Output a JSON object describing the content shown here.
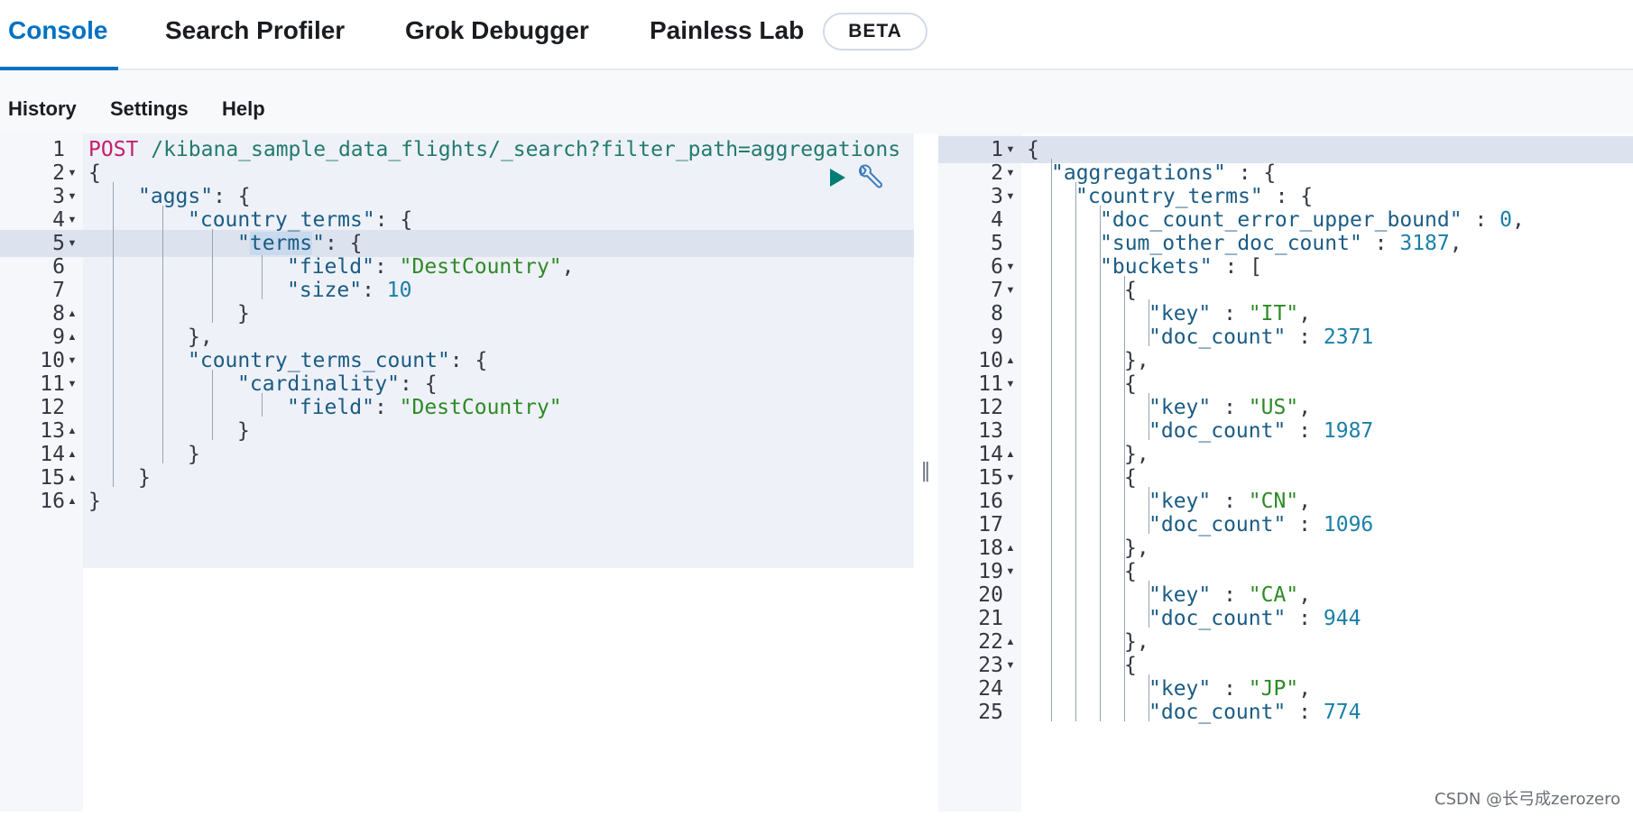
{
  "tabs": [
    {
      "label": "Console",
      "active": true
    },
    {
      "label": "Search Profiler"
    },
    {
      "label": "Grok Debugger"
    },
    {
      "label": "Painless Lab"
    }
  ],
  "beta_badge": "BETA",
  "subnav": {
    "history": "History",
    "settings": "Settings",
    "help": "Help"
  },
  "icons": {
    "run": "play-icon",
    "wrench": "wrench-icon",
    "resize": "resize-handle-icon"
  },
  "colors": {
    "accent": "#0071c2",
    "run_button": "#017d73"
  },
  "request": {
    "active_line": 5,
    "lines": [
      {
        "n": "1",
        "fold": "",
        "indent": 0,
        "tokens": [
          [
            "k-method",
            "POST"
          ],
          [
            "k-url",
            " /kibana_sample_data_flights/_search?filter_path=aggregations"
          ]
        ]
      },
      {
        "n": "2",
        "fold": "down",
        "indent": 0,
        "tokens": [
          [
            "k-punc",
            "{"
          ]
        ]
      },
      {
        "n": "3",
        "fold": "down",
        "indent": 1,
        "tokens": [
          [
            "k-key",
            "\"aggs\""
          ],
          [
            "k-punc",
            ": {"
          ]
        ]
      },
      {
        "n": "4",
        "fold": "down",
        "indent": 2,
        "tokens": [
          [
            "k-key",
            "\"country_terms\""
          ],
          [
            "k-punc",
            ": {"
          ]
        ]
      },
      {
        "n": "5",
        "fold": "down",
        "indent": 3,
        "tokens": [
          [
            "k-key",
            "\""
          ],
          [
            "k-key sel",
            "terms"
          ],
          [
            "k-key",
            "\""
          ],
          [
            "k-punc",
            ": {"
          ]
        ]
      },
      {
        "n": "6",
        "fold": "",
        "indent": 4,
        "tokens": [
          [
            "k-key",
            "\"field\""
          ],
          [
            "k-punc",
            ": "
          ],
          [
            "k-str",
            "\"DestCountry\""
          ],
          [
            "k-punc",
            ","
          ]
        ]
      },
      {
        "n": "7",
        "fold": "",
        "indent": 4,
        "tokens": [
          [
            "k-key",
            "\"size\""
          ],
          [
            "k-punc",
            ": "
          ],
          [
            "k-num",
            "10"
          ]
        ]
      },
      {
        "n": "8",
        "fold": "up",
        "indent": 3,
        "tokens": [
          [
            "k-punc",
            "}"
          ]
        ]
      },
      {
        "n": "9",
        "fold": "up",
        "indent": 2,
        "tokens": [
          [
            "k-punc",
            "},"
          ]
        ]
      },
      {
        "n": "10",
        "fold": "down",
        "indent": 2,
        "tokens": [
          [
            "k-key",
            "\"country_terms_count\""
          ],
          [
            "k-punc",
            ": {"
          ]
        ]
      },
      {
        "n": "11",
        "fold": "down",
        "indent": 3,
        "tokens": [
          [
            "k-key",
            "\"cardinality\""
          ],
          [
            "k-punc",
            ": {"
          ]
        ]
      },
      {
        "n": "12",
        "fold": "",
        "indent": 4,
        "tokens": [
          [
            "k-key",
            "\"field\""
          ],
          [
            "k-punc",
            ": "
          ],
          [
            "k-str",
            "\"DestCountry\""
          ]
        ]
      },
      {
        "n": "13",
        "fold": "up",
        "indent": 3,
        "tokens": [
          [
            "k-punc",
            "}"
          ]
        ]
      },
      {
        "n": "14",
        "fold": "up",
        "indent": 2,
        "tokens": [
          [
            "k-punc",
            "}"
          ]
        ]
      },
      {
        "n": "15",
        "fold": "up",
        "indent": 1,
        "tokens": [
          [
            "k-punc",
            "}"
          ]
        ]
      },
      {
        "n": "16",
        "fold": "up",
        "indent": 0,
        "tokens": [
          [
            "k-punc",
            "}"
          ]
        ]
      }
    ]
  },
  "response": {
    "active_line": 1,
    "lines": [
      {
        "n": "1",
        "fold": "down",
        "indent": 0,
        "tokens": [
          [
            "k-punc",
            "{"
          ]
        ]
      },
      {
        "n": "2",
        "fold": "down",
        "indent": 1,
        "tokens": [
          [
            "k-key",
            "\"aggregations\""
          ],
          [
            "k-punc",
            " : {"
          ]
        ]
      },
      {
        "n": "3",
        "fold": "down",
        "indent": 2,
        "tokens": [
          [
            "k-key",
            "\"country_terms\""
          ],
          [
            "k-punc",
            " : {"
          ]
        ]
      },
      {
        "n": "4",
        "fold": "",
        "indent": 3,
        "tokens": [
          [
            "k-key",
            "\"doc_count_error_upper_bound\""
          ],
          [
            "k-punc",
            " : "
          ],
          [
            "k-num",
            "0"
          ],
          [
            "k-punc",
            ","
          ]
        ]
      },
      {
        "n": "5",
        "fold": "",
        "indent": 3,
        "tokens": [
          [
            "k-key",
            "\"sum_other_doc_count\""
          ],
          [
            "k-punc",
            " : "
          ],
          [
            "k-num",
            "3187"
          ],
          [
            "k-punc",
            ","
          ]
        ]
      },
      {
        "n": "6",
        "fold": "down",
        "indent": 3,
        "tokens": [
          [
            "k-key",
            "\"buckets\""
          ],
          [
            "k-punc",
            " : ["
          ]
        ]
      },
      {
        "n": "7",
        "fold": "down",
        "indent": 4,
        "tokens": [
          [
            "k-punc",
            "{"
          ]
        ]
      },
      {
        "n": "8",
        "fold": "",
        "indent": 5,
        "tokens": [
          [
            "k-key",
            "\"key\""
          ],
          [
            "k-punc",
            " : "
          ],
          [
            "k-str",
            "\"IT\""
          ],
          [
            "k-punc",
            ","
          ]
        ]
      },
      {
        "n": "9",
        "fold": "",
        "indent": 5,
        "tokens": [
          [
            "k-key",
            "\"doc_count\""
          ],
          [
            "k-punc",
            " : "
          ],
          [
            "k-num",
            "2371"
          ]
        ]
      },
      {
        "n": "10",
        "fold": "up",
        "indent": 4,
        "tokens": [
          [
            "k-punc",
            "},"
          ]
        ]
      },
      {
        "n": "11",
        "fold": "down",
        "indent": 4,
        "tokens": [
          [
            "k-punc",
            "{"
          ]
        ]
      },
      {
        "n": "12",
        "fold": "",
        "indent": 5,
        "tokens": [
          [
            "k-key",
            "\"key\""
          ],
          [
            "k-punc",
            " : "
          ],
          [
            "k-str",
            "\"US\""
          ],
          [
            "k-punc",
            ","
          ]
        ]
      },
      {
        "n": "13",
        "fold": "",
        "indent": 5,
        "tokens": [
          [
            "k-key",
            "\"doc_count\""
          ],
          [
            "k-punc",
            " : "
          ],
          [
            "k-num",
            "1987"
          ]
        ]
      },
      {
        "n": "14",
        "fold": "up",
        "indent": 4,
        "tokens": [
          [
            "k-punc",
            "},"
          ]
        ]
      },
      {
        "n": "15",
        "fold": "down",
        "indent": 4,
        "tokens": [
          [
            "k-punc",
            "{"
          ]
        ]
      },
      {
        "n": "16",
        "fold": "",
        "indent": 5,
        "tokens": [
          [
            "k-key",
            "\"key\""
          ],
          [
            "k-punc",
            " : "
          ],
          [
            "k-str",
            "\"CN\""
          ],
          [
            "k-punc",
            ","
          ]
        ]
      },
      {
        "n": "17",
        "fold": "",
        "indent": 5,
        "tokens": [
          [
            "k-key",
            "\"doc_count\""
          ],
          [
            "k-punc",
            " : "
          ],
          [
            "k-num",
            "1096"
          ]
        ]
      },
      {
        "n": "18",
        "fold": "up",
        "indent": 4,
        "tokens": [
          [
            "k-punc",
            "},"
          ]
        ]
      },
      {
        "n": "19",
        "fold": "down",
        "indent": 4,
        "tokens": [
          [
            "k-punc",
            "{"
          ]
        ]
      },
      {
        "n": "20",
        "fold": "",
        "indent": 5,
        "tokens": [
          [
            "k-key",
            "\"key\""
          ],
          [
            "k-punc",
            " : "
          ],
          [
            "k-str",
            "\"CA\""
          ],
          [
            "k-punc",
            ","
          ]
        ]
      },
      {
        "n": "21",
        "fold": "",
        "indent": 5,
        "tokens": [
          [
            "k-key",
            "\"doc_count\""
          ],
          [
            "k-punc",
            " : "
          ],
          [
            "k-num",
            "944"
          ]
        ]
      },
      {
        "n": "22",
        "fold": "up",
        "indent": 4,
        "tokens": [
          [
            "k-punc",
            "},"
          ]
        ]
      },
      {
        "n": "23",
        "fold": "down",
        "indent": 4,
        "tokens": [
          [
            "k-punc",
            "{"
          ]
        ]
      },
      {
        "n": "24",
        "fold": "",
        "indent": 5,
        "tokens": [
          [
            "k-key",
            "\"key\""
          ],
          [
            "k-punc",
            " : "
          ],
          [
            "k-str",
            "\"JP\""
          ],
          [
            "k-punc",
            ","
          ]
        ]
      },
      {
        "n": "25",
        "fold": "",
        "indent": 5,
        "tokens": [
          [
            "k-key",
            "\"doc_count\""
          ],
          [
            "k-punc",
            " : "
          ],
          [
            "k-num",
            "774"
          ]
        ]
      }
    ]
  },
  "watermark": "CSDN @长弓成zerozero"
}
